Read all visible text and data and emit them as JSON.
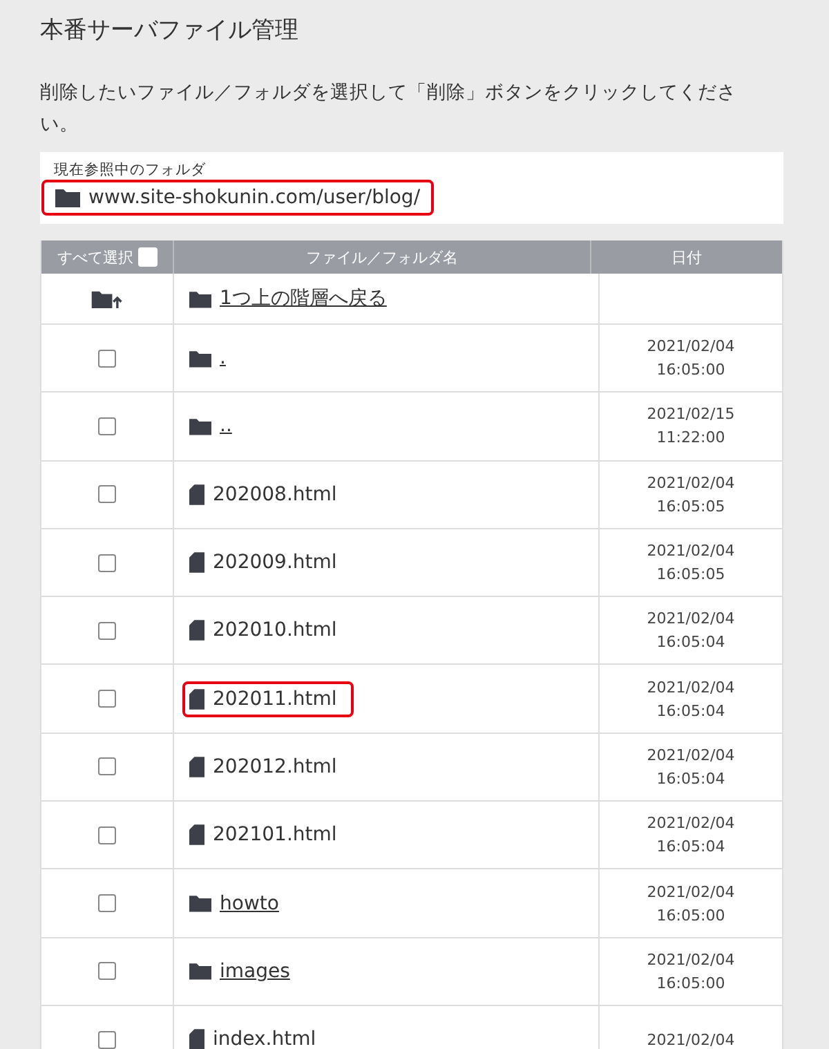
{
  "title": "本番サーバファイル管理",
  "description": "削除したいファイル／フォルダを選択して「削除」ボタンをクリックしてください。",
  "current_folder": {
    "label": "現在参照中のフォルダ",
    "path": "www.site-shokunin.com/user/blog/",
    "highlighted": true
  },
  "table": {
    "columns": [
      "すべて選択",
      "ファイル／フォルダ名",
      "日付"
    ],
    "select_all_checked": false,
    "rows": [
      {
        "kind": "parent",
        "name": "1つ上の階層へ戻る",
        "highlighted": false
      },
      {
        "kind": "folder",
        "name": ".",
        "date": "2021/02/04",
        "time": "16:05:00",
        "checked": false,
        "highlighted": false
      },
      {
        "kind": "folder",
        "name": "..",
        "date": "2021/02/15",
        "time": "11:22:00",
        "checked": false,
        "highlighted": false
      },
      {
        "kind": "file",
        "name": "202008.html",
        "date": "2021/02/04",
        "time": "16:05:05",
        "checked": false,
        "highlighted": false
      },
      {
        "kind": "file",
        "name": "202009.html",
        "date": "2021/02/04",
        "time": "16:05:05",
        "checked": false,
        "highlighted": false
      },
      {
        "kind": "file",
        "name": "202010.html",
        "date": "2021/02/04",
        "time": "16:05:04",
        "checked": false,
        "highlighted": false
      },
      {
        "kind": "file",
        "name": "202011.html",
        "date": "2021/02/04",
        "time": "16:05:04",
        "checked": false,
        "highlighted": true
      },
      {
        "kind": "file",
        "name": "202012.html",
        "date": "2021/02/04",
        "time": "16:05:04",
        "checked": false,
        "highlighted": false
      },
      {
        "kind": "file",
        "name": "202101.html",
        "date": "2021/02/04",
        "time": "16:05:04",
        "checked": false,
        "highlighted": false
      },
      {
        "kind": "folder",
        "name": "howto",
        "date": "2021/02/04",
        "time": "16:05:00",
        "checked": false,
        "highlighted": false
      },
      {
        "kind": "folder",
        "name": "images",
        "date": "2021/02/04",
        "time": "16:05:00",
        "checked": false,
        "highlighted": false
      },
      {
        "kind": "file",
        "name": "index.html",
        "date": "2021/02/04",
        "checked": false,
        "highlighted": false
      }
    ]
  }
}
